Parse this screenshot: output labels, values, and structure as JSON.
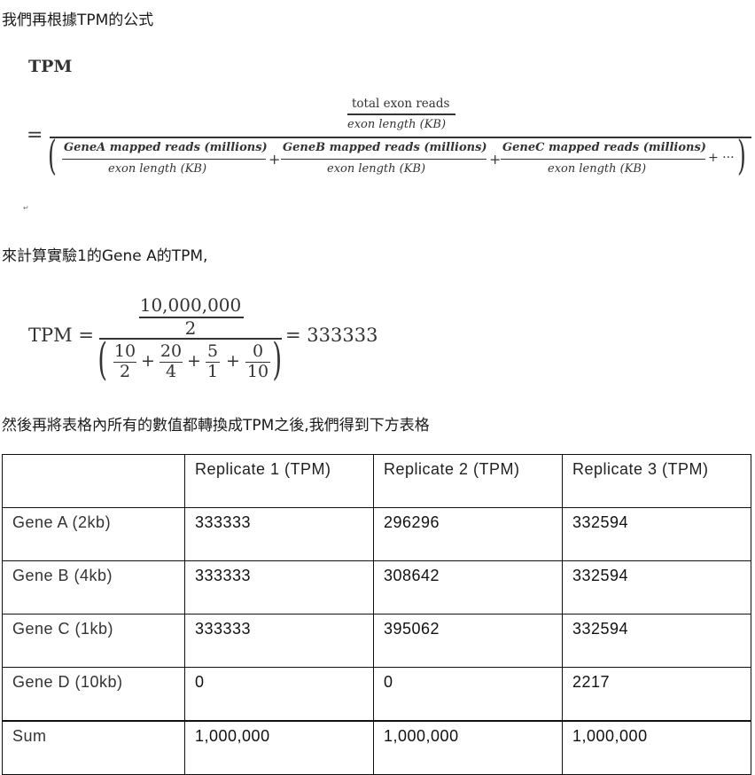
{
  "intro_line": "我們再根據TPM的公式",
  "formula": {
    "lhs": "TPM",
    "equals": "=",
    "top_num": "total exon reads",
    "top_den": "exon length (KB)",
    "terms": [
      {
        "num": "GeneA mapped reads (millions)",
        "den": "exon length (KB)"
      },
      {
        "num": "GeneB mapped reads (millions)",
        "den": "exon length (KB)"
      },
      {
        "num": "GeneC mapped reads (millions)",
        "den": "exon length (KB)"
      }
    ],
    "plus": "+",
    "ellipsis": "+ ···",
    "mark": "↵"
  },
  "calc_line": "來計算實驗1的Gene A的TPM,",
  "example": {
    "lhs": "TPM =",
    "top_num": "10,000,000",
    "top_den": "2",
    "fracs": [
      {
        "num": "10",
        "den": "2"
      },
      {
        "num": "20",
        "den": "4"
      },
      {
        "num": "5",
        "den": "1"
      },
      {
        "num": "0",
        "den": "10"
      }
    ],
    "plus": "+",
    "result": "= 333333"
  },
  "after_line": "然後再將表格內所有的數值都轉換成TPM之後,我們得到下方表格",
  "table": {
    "headers": [
      "",
      "Replicate 1 (TPM)",
      "Replicate 2 (TPM)",
      "Replicate 3 (TPM)"
    ],
    "rows": [
      {
        "label": "Gene A (2kb)",
        "values": [
          "333333",
          "296296",
          "332594"
        ]
      },
      {
        "label": "Gene B (4kb)",
        "values": [
          "333333",
          "308642",
          "332594"
        ]
      },
      {
        "label": "Gene C (1kb)",
        "values": [
          "333333",
          "395062",
          "332594"
        ]
      },
      {
        "label": "Gene D (10kb)",
        "values": [
          "0",
          "0",
          "2217"
        ]
      }
    ],
    "sum": {
      "label": "Sum",
      "values": [
        "1,000,000",
        "1,000,000",
        "1,000,000"
      ]
    }
  }
}
